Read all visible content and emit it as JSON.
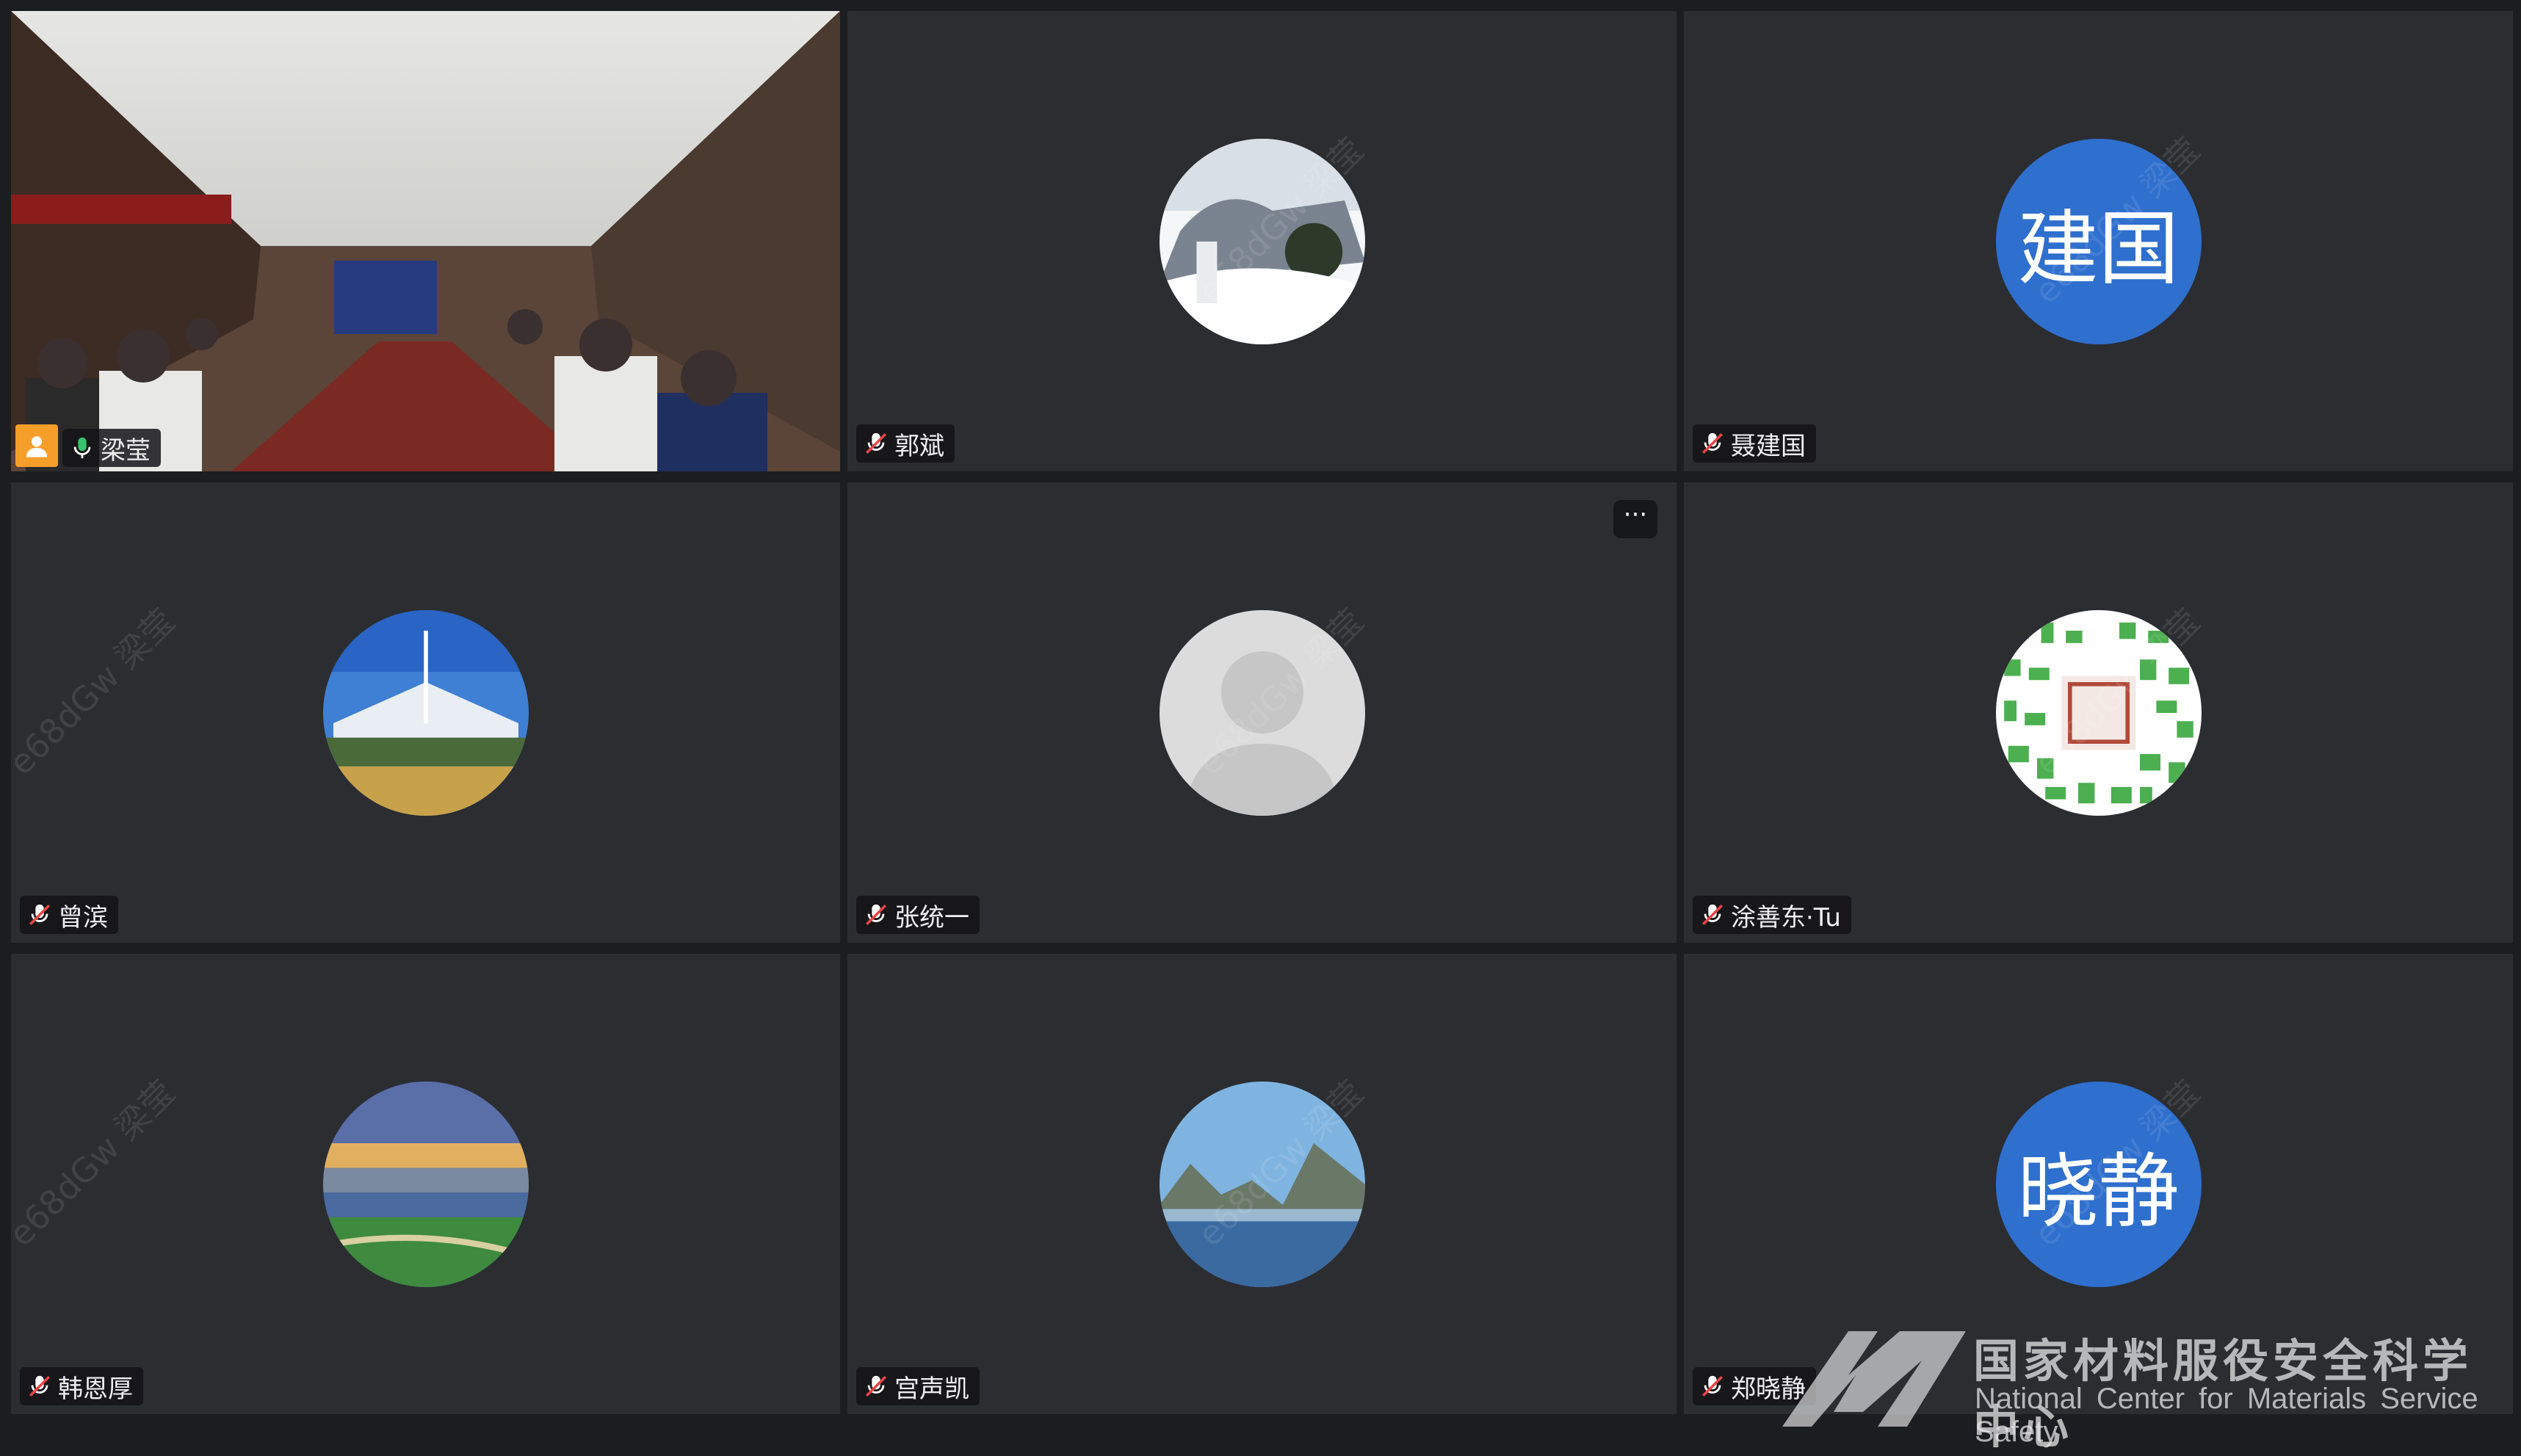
{
  "participants": [
    {
      "name": "梁莹",
      "type": "video",
      "active": true,
      "mic": "on"
    },
    {
      "name": "郭斌",
      "type": "avatar-image",
      "avatar": "snow-landscape",
      "mic": "muted"
    },
    {
      "name": "聂建国",
      "type": "avatar-text",
      "avatar_text": "建国",
      "mic": "muted"
    },
    {
      "name": "曾滨",
      "type": "avatar-image",
      "avatar": "stadium",
      "mic": "muted"
    },
    {
      "name": "张统一",
      "type": "avatar-image",
      "avatar": "default-person",
      "mic": "muted",
      "more_button": "···"
    },
    {
      "name": "涂善东·Tu",
      "type": "avatar-image",
      "avatar": "qr-seal",
      "mic": "muted"
    },
    {
      "name": "韩恩厚",
      "type": "avatar-image",
      "avatar": "city-lake",
      "mic": "muted"
    },
    {
      "name": "宫声凯",
      "type": "avatar-image",
      "avatar": "mountain-lake",
      "mic": "muted"
    },
    {
      "name": "郑晓静",
      "type": "avatar-text",
      "avatar_text": "晓静",
      "mic": "muted"
    }
  ],
  "watermark": {
    "name": "梁莹",
    "code": "e68dGw"
  },
  "logo": {
    "name_cn": "国家材料服役安全科学中心",
    "name_en": "National Center for Materials Service Safety"
  },
  "colors": {
    "active_border": "#3cd07a",
    "text_avatar_bg": "#2f6fce",
    "tile_bg": "#2b2d31"
  }
}
